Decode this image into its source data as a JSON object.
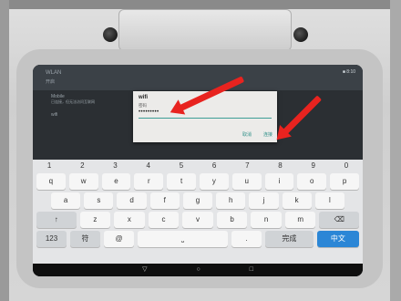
{
  "status": {
    "badge": "■ 8:10"
  },
  "background_app": {
    "header_title": "WLAN",
    "header_sub": "开启",
    "network_name": "Mobile",
    "network_status": "已连接，但无法访问互联网",
    "other_network": "wifi"
  },
  "dialog": {
    "title": "wifi",
    "label": "密码",
    "password": "•••••••••",
    "cancel": "取消",
    "connect": "连接"
  },
  "keyboard": {
    "number_row": [
      "1",
      "2",
      "3",
      "4",
      "5",
      "6",
      "7",
      "8",
      "9",
      "0"
    ],
    "row1": [
      "q",
      "w",
      "e",
      "r",
      "t",
      "y",
      "u",
      "i",
      "o",
      "p"
    ],
    "row2": [
      "a",
      "s",
      "d",
      "f",
      "g",
      "h",
      "j",
      "k",
      "l"
    ],
    "row3": [
      "↑",
      "z",
      "x",
      "c",
      "v",
      "b",
      "n",
      "m",
      "⌫"
    ],
    "row4": [
      "123",
      "符",
      "@",
      "⎵",
      ".",
      "完成",
      "中文"
    ]
  },
  "nav": {
    "back": "▽",
    "home": "○",
    "recents": "□"
  },
  "colors": {
    "arrow": "#e8231f",
    "accent": "#2f8f88",
    "done_key": "#2b86d6"
  }
}
